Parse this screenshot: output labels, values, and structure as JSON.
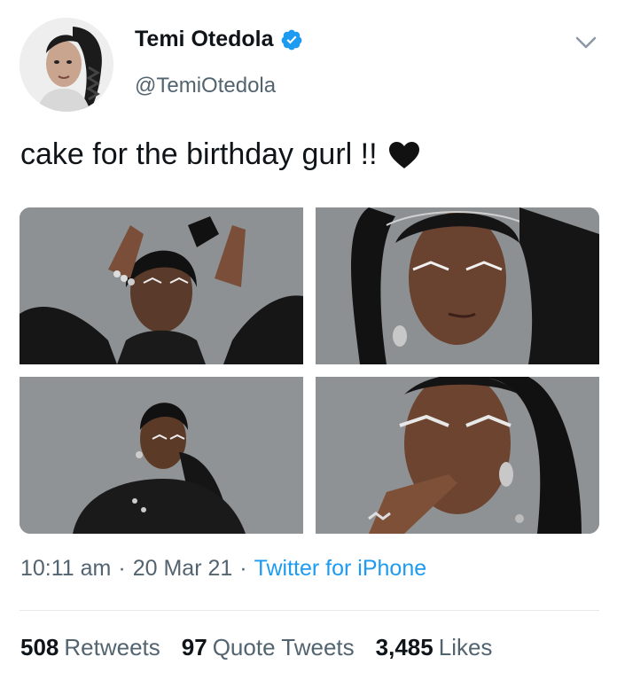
{
  "author": {
    "name": "Temi Otedola",
    "handle": "@TemiOtedola",
    "verified": true
  },
  "tweet": {
    "text": "cake for the birthday gurl !!",
    "emoji": "black-heart"
  },
  "media": [
    {
      "name": "photo-1"
    },
    {
      "name": "photo-2"
    },
    {
      "name": "photo-3"
    },
    {
      "name": "photo-4"
    }
  ],
  "meta": {
    "time": "10:11 am",
    "date": "20 Mar 21",
    "separator": "·",
    "source": "Twitter for iPhone"
  },
  "stats": {
    "retweets": {
      "count": "508",
      "label": "Retweets"
    },
    "quotes": {
      "count": "97",
      "label": "Quote Tweets"
    },
    "likes": {
      "count": "3,485",
      "label": "Likes"
    }
  },
  "colors": {
    "verified": "#1d9bf0",
    "link": "#1d9bf0",
    "secondary_text": "#536471"
  }
}
